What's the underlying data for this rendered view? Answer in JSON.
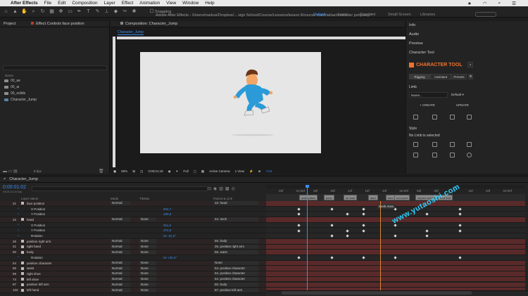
{
  "menubar": {
    "items": [
      "After Effects",
      "File",
      "Edit",
      "Composition",
      "Layer",
      "Effect",
      "Animation",
      "View",
      "Window",
      "Help"
    ],
    "right_icons": [
      "star-icon",
      "wifi-icon",
      "search-icon",
      "menu-icon"
    ]
  },
  "window_title": "Adobe After Effects - /Users/markus/Dropbox/... sign School/Course/Lessons/lesson 8/course material/ae/character jump.aep *",
  "toolbar": {
    "snapping_label": "Snapping",
    "workspaces": [
      "Default",
      "Learn",
      "Standard",
      "Small Screen",
      "Libraries"
    ],
    "active_workspace": "Default"
  },
  "project": {
    "tab1": "Project",
    "tab2": "Effect Controls face position",
    "column_name": "Name",
    "items": [
      "00_ae",
      "00_ai",
      "00_solids",
      "Character_Jump"
    ],
    "bpc": "8 bpc"
  },
  "composition": {
    "tab": "Composition: Character_Jump",
    "subtab": "Character_Jump",
    "zoom": "50%",
    "timecode": "0;00;01;18",
    "resolution": "Full",
    "camera": "Active Camera",
    "view": "1 View",
    "exposure": "+0,0"
  },
  "rightpanel": {
    "sections": [
      "Info",
      "Audio",
      "Preview"
    ],
    "tool_title": "Character Tool",
    "brand": "CHARACTER TOOL",
    "help": "?",
    "tabs": [
      "Rigging",
      "Assistant",
      "Presets"
    ],
    "limb_label": "Limb",
    "name_placeholder": "Name...",
    "preset": "Default",
    "create": "+ CREATE",
    "update": "UPDATE",
    "style_label": "Style",
    "no_limb": "No Limb is selected"
  },
  "timeline": {
    "tab": "Character_Jump",
    "timecode": "0:00:01:02",
    "fps": "00026 (24,00 fps)",
    "columns": {
      "layer_name": "Layer Name",
      "mode": "Mode",
      "trkmat": "TrkMat",
      "parent": "Parent & Link"
    },
    "ruler": [
      "00f",
      "01:00f",
      "06f",
      "08f",
      "12f",
      "18f",
      "20f",
      "02:00f",
      "06f",
      "08f",
      "12f",
      "16f",
      "20f",
      "03:00f"
    ],
    "markers": [
      "anticipation",
      "jump",
      "air start",
      "land",
      "land end",
      "end pose",
      "impact residue",
      "final end"
    ],
    "work_area": "Work Area",
    "layers": [
      {
        "num": "21",
        "name": "face position",
        "mode": "Normal",
        "trk": "",
        "val": "",
        "parent": "22. head",
        "red": true
      },
      {
        "num": "",
        "name": "X Position",
        "mode": "",
        "trk": "",
        "val": "924,7",
        "parent": "",
        "red": false
      },
      {
        "num": "",
        "name": "Y Position",
        "mode": "",
        "trk": "",
        "val": "190,6",
        "parent": "",
        "red": false
      },
      {
        "num": "22",
        "name": "head",
        "mode": "Normal",
        "trk": "None",
        "val": "",
        "parent": "44. neck",
        "red": true
      },
      {
        "num": "",
        "name": "X Position",
        "mode": "",
        "trk": "",
        "val": "911,8",
        "parent": "",
        "red": false
      },
      {
        "num": "",
        "name": "Y Position",
        "mode": "",
        "trk": "",
        "val": "272,6",
        "parent": "",
        "red": false
      },
      {
        "num": "",
        "name": "Rotation",
        "mode": "",
        "trk": "",
        "val": "0x -22,2°",
        "parent": "",
        "red": false
      },
      {
        "num": "26",
        "name": "position right arm",
        "mode": "Normal",
        "trk": "None",
        "val": "",
        "parent": "50. body",
        "red": true
      },
      {
        "num": "41",
        "name": "right hand",
        "mode": "Normal",
        "trk": "None",
        "val": "",
        "parent": "26. position right arm",
        "red": true
      },
      {
        "num": "50",
        "name": "body",
        "mode": "Normal",
        "trk": "None",
        "val": "",
        "parent": "55. waist",
        "red": true
      },
      {
        "num": "",
        "name": "Rotation",
        "mode": "",
        "trk": "",
        "val": "0x +20,4°",
        "parent": "",
        "red": false
      },
      {
        "num": "54",
        "name": "position character",
        "mode": "Normal",
        "trk": "None",
        "val": "",
        "parent": "None",
        "red": true
      },
      {
        "num": "55",
        "name": "waist",
        "mode": "Normal",
        "trk": "None",
        "val": "",
        "parent": "54. position character",
        "red": true
      },
      {
        "num": "59",
        "name": "right shoe",
        "mode": "Normal",
        "trk": "None",
        "val": "",
        "parent": "54. position character",
        "red": true
      },
      {
        "num": "74",
        "name": "left shoe",
        "mode": "Normal",
        "trk": "None",
        "val": "",
        "parent": "54. position character",
        "red": true
      },
      {
        "num": "87",
        "name": "position left arm",
        "mode": "Normal",
        "trk": "None",
        "val": "",
        "parent": "50. body",
        "red": true
      },
      {
        "num": "102",
        "name": "left hand",
        "mode": "Normal",
        "trk": "None",
        "val": "",
        "parent": "87. position left arm",
        "red": true
      }
    ]
  },
  "watermark": "www.yutaoshi.com",
  "colors": {
    "accent": "#3b8ef0",
    "brand": "#f0732c",
    "layer_red": "#5a2a2a"
  }
}
